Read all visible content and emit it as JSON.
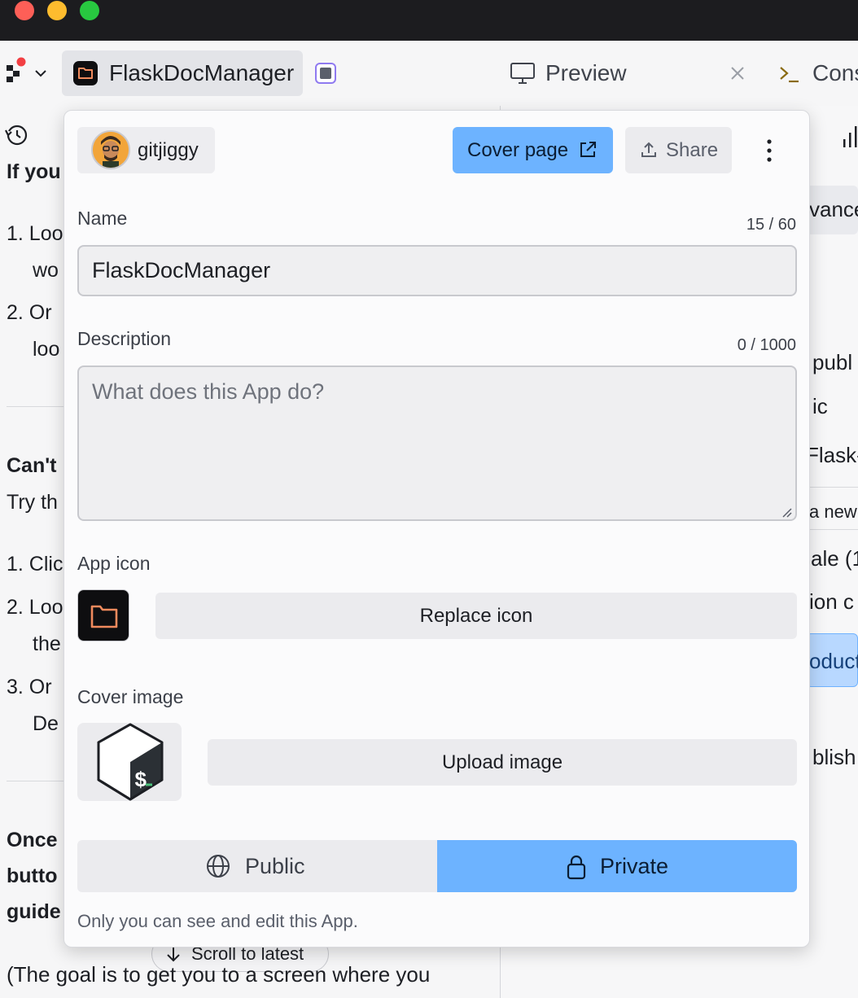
{
  "toolbar": {
    "app_tab_label": "FlaskDocManager",
    "preview_label": "Preview",
    "console_label": "Cons"
  },
  "background_left": {
    "heading_1": "If you",
    "item_1a": "1. Loo",
    "item_1b": "wo",
    "item_2a": "2. Or",
    "item_2b": "loo",
    "heading_2": "Can't",
    "try_line": "Try th",
    "item_3a": "1. Clic",
    "item_4a": "2. Loo",
    "item_4b": "the",
    "item_5a": "3. Or",
    "item_5b": "De",
    "once_1": "Once",
    "once_2": "butto",
    "once_3": "guide",
    "scroll_to_latest": "Scroll to latest",
    "bottom_line": "(The goal is to get you to a screen where you"
  },
  "background_right": {
    "advanced": "vance",
    "publ": "publ",
    "ic": "ic",
    "flask": "Flask-",
    "anew": "a new",
    "ale": "ale  (1",
    "ion": "ion c",
    "oduct": "oduct",
    "blish": "blish"
  },
  "modal": {
    "owner_name": "gitjiggy",
    "cover_page_label": "Cover page",
    "share_label": "Share",
    "name_label": "Name",
    "name_counter": "15 / 60",
    "name_value": "FlaskDocManager",
    "description_label": "Description",
    "description_counter": "0 / 1000",
    "description_placeholder": "What does this App do?",
    "app_icon_label": "App icon",
    "replace_icon_label": "Replace icon",
    "cover_image_label": "Cover image",
    "upload_image_label": "Upload image",
    "visibility": {
      "public_label": "Public",
      "private_label": "Private",
      "selected": "Private"
    },
    "hint": "Only you can see and edit this App."
  },
  "colors": {
    "accent_blue": "#6db3ff",
    "folder_orange": "#f08a5d",
    "stop_purple": "#8f7af0"
  }
}
